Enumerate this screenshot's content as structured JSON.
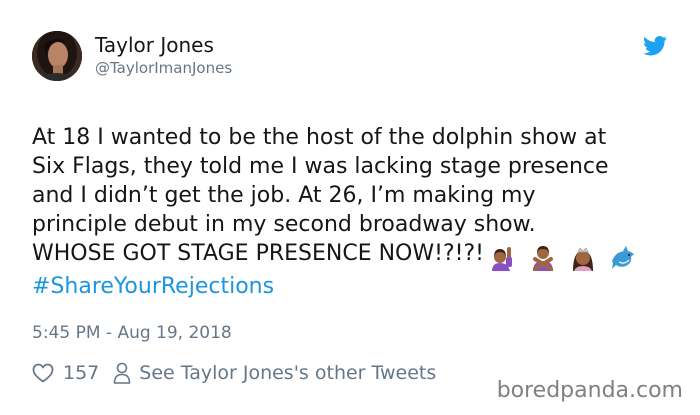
{
  "author": {
    "display_name": "Taylor Jones",
    "handle": "@TaylorImanJones"
  },
  "icons": {
    "platform": "twitter-bird-icon",
    "like": "heart-outline-icon",
    "profile": "person-outline-icon",
    "emojis": [
      "woman-raising-hand-emoji",
      "woman-gesturing-no-emoji",
      "princess-emoji",
      "dolphin-emoji"
    ]
  },
  "tweet": {
    "lines": [
      "At 18 I wanted to be the host of the dolphin show at",
      "Six Flags, they told me I was lacking stage presence",
      "and I didn’t get the job. At 26, I’m making my",
      "principle debut in my second broadway show.",
      "WHOSE GOT STAGE PRESENCE NOW!?!?!"
    ],
    "hashtag": "#ShareYourRejections",
    "timestamp": "5:45 PM - Aug 19, 2018"
  },
  "actions": {
    "like_count": "157",
    "other_tweets_label": "See Taylor Jones's other Tweets"
  },
  "watermark": "boredpanda.com",
  "colors": {
    "link_blue": "#1b95e0",
    "secondary_text": "#657786",
    "primary_text": "#14171a",
    "twitter_blue": "#1da1f2"
  }
}
